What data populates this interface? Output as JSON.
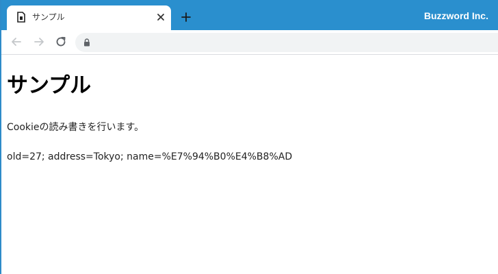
{
  "tab": {
    "title": "サンプル"
  },
  "profile": {
    "label": "Buzzword Inc."
  },
  "address_bar": {
    "value": "",
    "placeholder": ""
  },
  "page": {
    "heading": "サンプル",
    "description": "Cookieの読み書きを行います。",
    "cookie_text": "old=27; address=Tokyo; name=%E7%94%B0%E4%B8%AD"
  },
  "colors": {
    "tabstrip": "#2a8fce",
    "omnibox": "#f1f3f4",
    "page_background": "#ffffff"
  },
  "icons": {
    "favicon": "page-file-icon",
    "close": "close-icon",
    "new_tab": "plus-icon",
    "back": "arrow-left-icon",
    "forward": "arrow-right-icon",
    "reload": "reload-icon",
    "secure": "lock-icon"
  }
}
